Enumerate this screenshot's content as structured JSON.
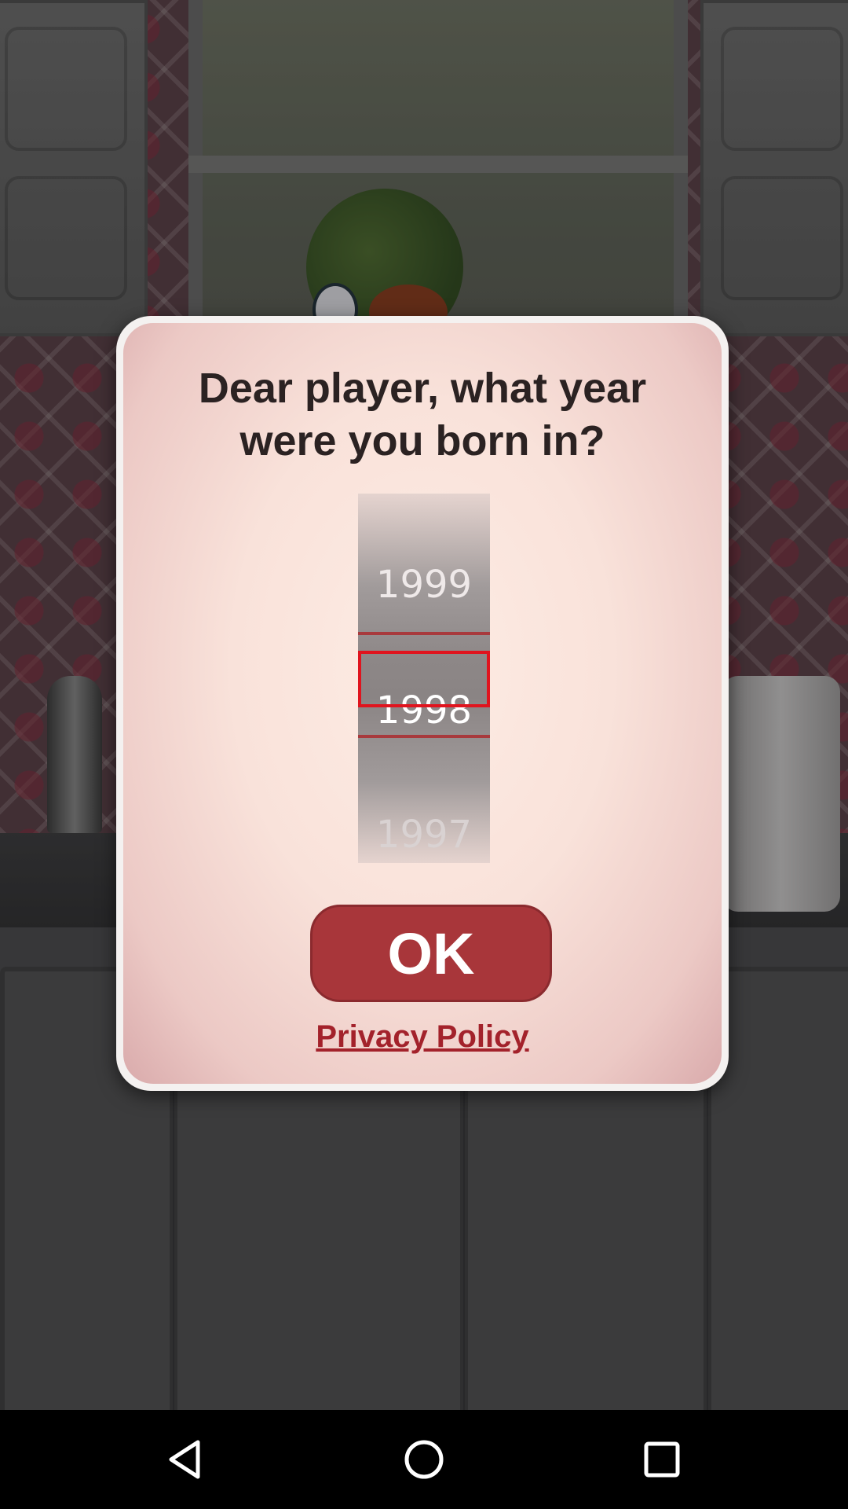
{
  "dialog": {
    "title": "Dear player, what year were you born in?",
    "ok_label": "OK",
    "privacy_label": "Privacy Policy"
  },
  "year_picker": {
    "previous_year": "1999",
    "selected_year": "1998",
    "next_year": "1997"
  },
  "nav_bar": {
    "back_icon": "back-triangle-icon",
    "home_icon": "home-circle-icon",
    "recent_icon": "recent-apps-square-icon"
  },
  "colors": {
    "ok_button": "#a8363a",
    "privacy_link": "#a3222b",
    "focus_box": "#e0141e"
  }
}
